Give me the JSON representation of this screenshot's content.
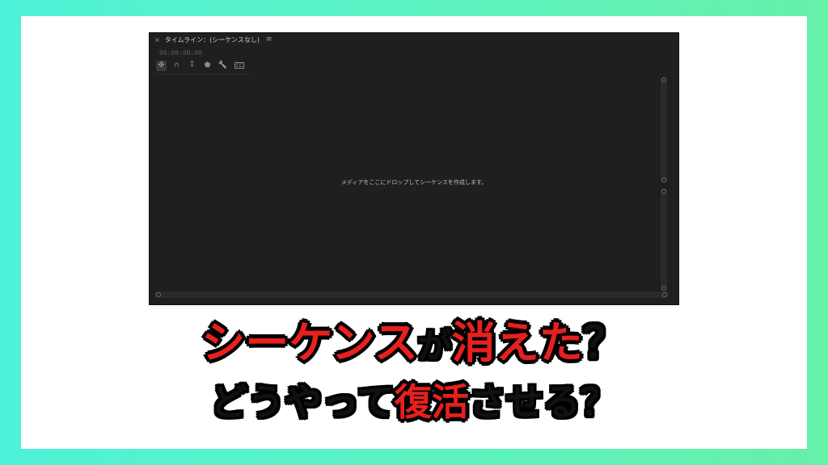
{
  "panel": {
    "close_glyph": "×",
    "title": "タイムライン：(シーケンスなし)",
    "menu_glyph": "≡",
    "timecode": "00:00:00:00",
    "toolbar": [
      {
        "name": "nest-toggle-icon",
        "glyph": "✣",
        "active": true
      },
      {
        "name": "snap-magnet-icon",
        "glyph": "∩",
        "active": false
      },
      {
        "name": "linked-selection-icon",
        "glyph": "⁑",
        "active": false
      },
      {
        "name": "add-marker-icon",
        "glyph": "⬟",
        "active": false
      },
      {
        "name": "timeline-settings-wrench-icon",
        "glyph": "🔧",
        "active": false
      },
      {
        "name": "captions-cc-icon",
        "glyph": "CC",
        "active": false
      }
    ],
    "drop_hint": "メディアをここにドロップしてシーケンスを作成します。"
  },
  "headline": {
    "line1": {
      "part1": "シーケンス",
      "part2": "が",
      "part3": "消えた",
      "part4": "？"
    },
    "line2": {
      "part1": "どうやって",
      "part2": "復活",
      "part3": "させる？"
    }
  },
  "colors": {
    "background_gradient": [
      "#4ef2d8",
      "#66f0a8"
    ],
    "panel": "#1f1f1f",
    "accent_red": "#e8201e"
  }
}
